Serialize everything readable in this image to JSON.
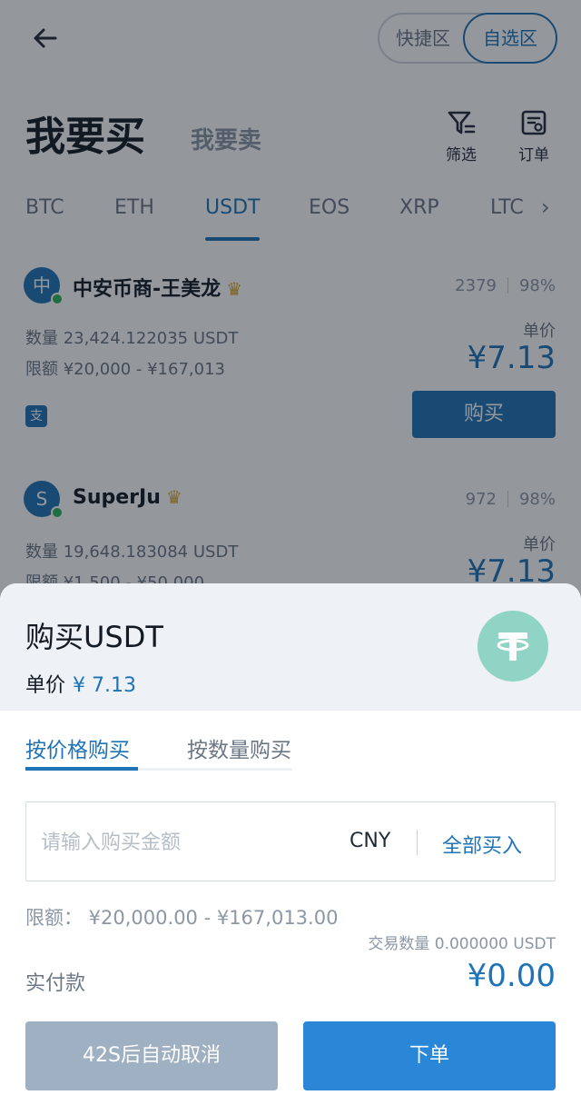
{
  "top_bar": {
    "quick_zone_label": "快捷区",
    "favorites_zone_label": "自选区"
  },
  "title_row": {
    "buy_title": "我要买",
    "sell_title": "我要卖",
    "filter_label": "筛选",
    "orders_label": "订单"
  },
  "coin_tabs": [
    "BTC",
    "ETH",
    "USDT",
    "EOS",
    "XRP",
    "LTC"
  ],
  "active_coin": "USDT",
  "listings": [
    {
      "avatar_char": "中",
      "merchant": "中安币商-王美龙",
      "trades": "2379",
      "completion": "98%",
      "quantity": "数量 23,424.122035 USDT",
      "limit": "限额 ¥20,000 - ¥167,013",
      "price_label": "单价",
      "price": "¥7.13",
      "payment_badge": "支",
      "buy_label": "购买"
    },
    {
      "avatar_char": "S",
      "merchant": "SuperJu",
      "trades": "972",
      "completion": "98%",
      "quantity": "数量 19,648.183084 USDT",
      "limit": "限额 ¥1,500 - ¥50,000",
      "price_label": "单价",
      "price": "¥7.13"
    }
  ],
  "sheet": {
    "title": "购买USDT",
    "unit_price_label": "单价",
    "unit_price_value": "¥ 7.13",
    "tab_by_price": "按价格购买",
    "tab_by_quantity": "按数量购买",
    "amount_placeholder": "请输入购买金额",
    "currency": "CNY",
    "buy_all_label": "全部买入",
    "limit_text": "限额： ¥20,000.00 - ¥167,013.00",
    "trade_quantity_text": "交易数量 0.000000 USDT",
    "actual_pay_label": "实付款",
    "actual_pay_value": "¥0.00",
    "cancel_label": "42S后自动取消",
    "order_label": "下单"
  },
  "colors": {
    "accent": "#1f73b7",
    "primary_button": "#2a87d8",
    "disabled_button": "#9fb0c2",
    "tether": "#8fd4c4",
    "online": "#2fb35b",
    "vip_gold": "#d9a72a"
  },
  "icons": [
    "back-arrow-icon",
    "filter-icon",
    "orders-icon",
    "chevron-right-icon",
    "vip-crown-icon",
    "tether-icon"
  ]
}
